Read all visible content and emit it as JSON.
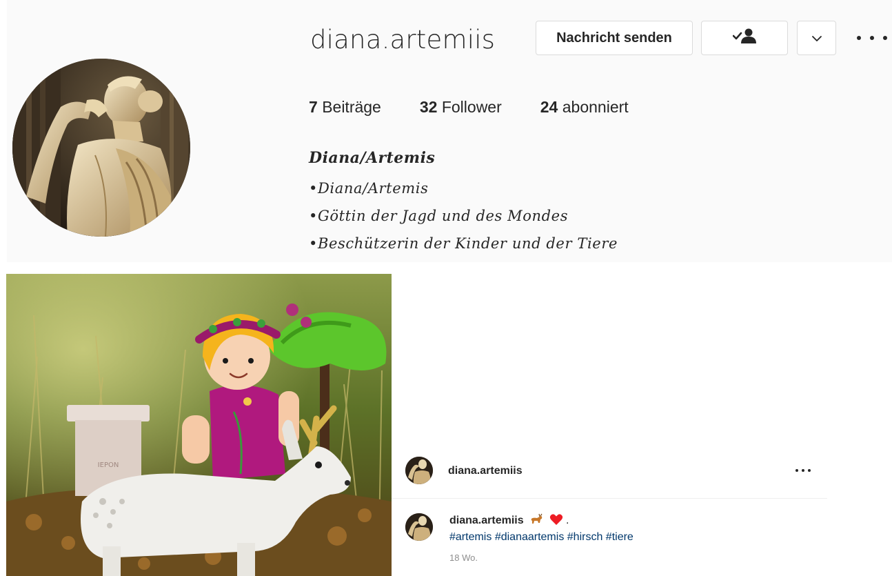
{
  "profile": {
    "username": "diana.artemiis",
    "message_button": "Nachricht senden",
    "stats": {
      "posts_count": "7",
      "posts_label": "Beiträge",
      "followers_count": "32",
      "followers_label": "Follower",
      "following_count": "24",
      "following_label": "abonniert"
    },
    "bio": {
      "title": "Diana/Artemis",
      "lines": [
        "•Diana/Artemis",
        "•Göttin der Jagd und des Mondes",
        "•Beschützerin der Kinder und der Tiere"
      ]
    }
  },
  "post": {
    "author": "diana.artemiis",
    "caption_user": "diana.artemiis",
    "caption_text": ".",
    "caption_emojis": [
      "deer-emoji",
      "heart-emoji"
    ],
    "hashtags": [
      "#artemis",
      "#dianaartemis",
      "#hirsch",
      "#tiere"
    ],
    "timestamp": "18 Wo."
  },
  "icons": {
    "following": "person-check-icon",
    "dropdown": "chevron-down-icon",
    "more": "more-horizontal-icon"
  },
  "colors": {
    "background": "#fafafa",
    "text": "#262626",
    "border": "#dbdbdb",
    "hashtag": "#00376b",
    "muted": "#8e8e8e",
    "heart": "#ed1c24"
  }
}
